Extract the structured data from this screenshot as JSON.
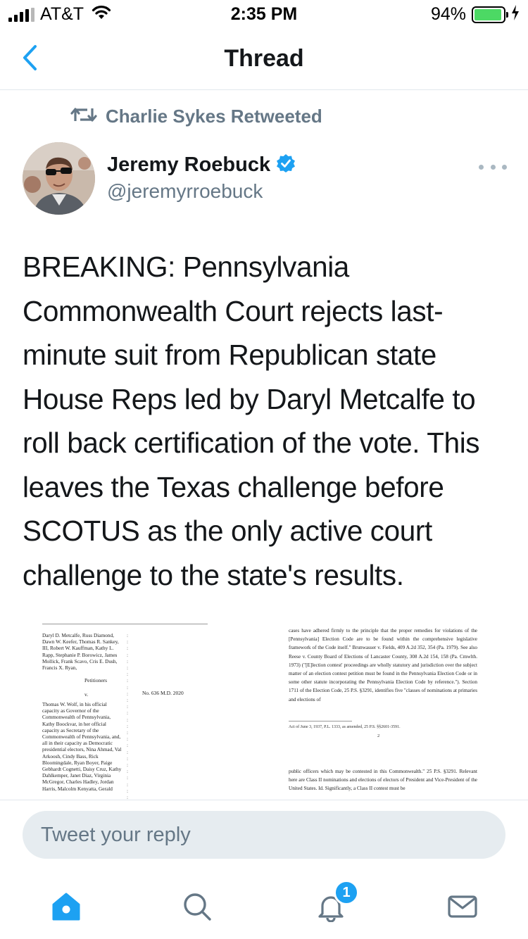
{
  "status_bar": {
    "carrier": "AT&T",
    "time": "2:35 PM",
    "battery_percent": "94%",
    "battery_level": 0.94,
    "signal_bars": 4,
    "signal_bars_total": 5,
    "icons": [
      "signal-icon",
      "wifi-icon",
      "battery-icon",
      "charging-icon"
    ]
  },
  "nav": {
    "title": "Thread",
    "back_icon": "chevron-left-icon"
  },
  "tweet": {
    "retweeted_by": "Charlie Sykes Retweeted",
    "author_name": "Jeremy Roebuck",
    "author_handle": "@jeremyrroebuck",
    "verified": true,
    "text": "BREAKING: Pennsylvania Commonwealth Court rejects last-minute suit from Republican state House Reps led by Daryl Metcalfe to roll back certification of the vote. This leaves the Texas challenge before SCOTUS as the only active court challenge to the state's results.",
    "media": {
      "left_page": {
        "petitioners": "Daryl D. Metcalfe, Russ Diamond, Dawn W. Keefer, Thomas R. Sankey, III, Robert W. Kauffman, Kathy L. Rapp, Stephanie P. Borowicz, James Mollick, Frank Scavo, Cris E. Dush, Francis X. Ryan,",
        "petitioners_label": "Petitioners",
        "versus": "v.",
        "case_number": "No. 636 M.D. 2020",
        "respondents": "Thomas W. Wolf, in his official capacity as Governor of the Commonwealth of Pennsylvania, Kathy Boockvar, in her official capacity as Secretary of the Commonwealth of Pennsylvania, and, all in their capacity as Democratic presidential electors, Nina Ahmad, Val Arkoosh, Cindy Bass, Rick Bloomingdale, Ryan Boyer, Paige Gebhardt Cognetti, Daisy Cruz, Kathy Dahlkemper, Janet Diaz, Virginia McGregor, Charles Hadley, Jordan Harris, Malcolm Kenyatta, Gerald"
      },
      "right_page": {
        "paragraph_1": "cases have adhered firmly to the principle that the proper remedies for violations of the [Pennsylvania] Election Code are to be found within the comprehensive legislative framework of the Code itself.\" Brunwasser v. Fields, 409 A.2d 352, 354 (Pa. 1979). See also Reese v. County Board of Elections of Lancaster County, 308 A.2d 154, 158 (Pa. Cmwlth. 1973) (\"[E]lection contest' proceedings are wholly statutory and jurisdiction over the subject matter of an election contest petition must be found in the Pennsylvania Election Code or in some other statute incorporating the Pennsylvania Election Code by reference.\"). Section 1711 of the Election Code, 25 P.S. §3291, identifies five \"classes of nominations at primaries and elections of",
        "footnote": "Act of June 3, 1937, P.L. 1333, as amended, 25 P.S. §§2601-3591.",
        "page_number": "2",
        "paragraph_2": "public officers which may be contested in this Commonwealth.\" 25 P.S. §3291. Relevant here are Class II nominations and elections of electors of President and Vice-President of the United States. Id. Significantly, a Class II contest must be"
      }
    }
  },
  "reply": {
    "placeholder": "Tweet your reply"
  },
  "tabbar": {
    "items": [
      {
        "name": "home-icon",
        "active": true
      },
      {
        "name": "search-icon",
        "active": false
      },
      {
        "name": "notifications-icon",
        "active": false
      },
      {
        "name": "messages-icon",
        "active": false
      }
    ],
    "notifications_badge": "1"
  },
  "colors": {
    "accent": "#1da1f2",
    "text": "#14171a",
    "secondary_text": "#657786",
    "reply_bg": "#e6ecf0",
    "battery": "#4cd964"
  }
}
